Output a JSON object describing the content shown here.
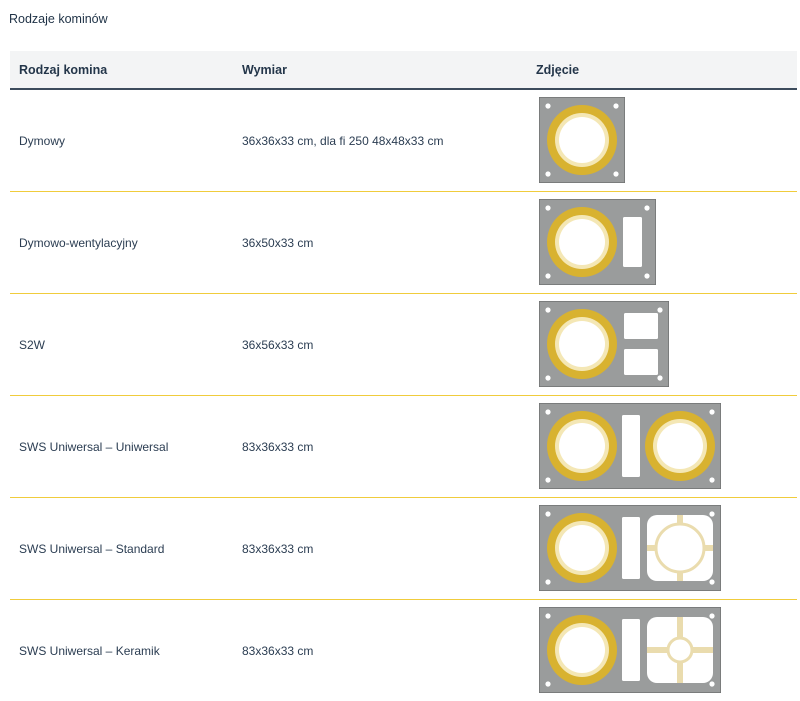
{
  "caption": "Rodzaje kominów",
  "headers": {
    "type": "Rodzaj komina",
    "size": "Wymiar",
    "photo": "Zdjęcie"
  },
  "rows": [
    {
      "type": "Dymowy",
      "size": "36x36x33 cm, dla fi 250 48x48x33 cm",
      "image": "chimney-single-flue"
    },
    {
      "type": "Dymowo-wentylacyjny",
      "size": "36x50x33 cm",
      "image": "chimney-flue-vent"
    },
    {
      "type": "S2W",
      "size": "36x56x33 cm",
      "image": "chimney-flue-two-vents"
    },
    {
      "type": "SWS Uniwersal – Uniwersal",
      "size": "83x36x33 cm",
      "image": "chimney-double-flue"
    },
    {
      "type": "SWS Uniwersal – Standard",
      "size": "83x36x33 cm",
      "image": "chimney-double-flue-standard"
    },
    {
      "type": "SWS Uniwersal – Keramik",
      "size": "83x36x33 cm",
      "image": "chimney-double-flue-keramik"
    }
  ],
  "colors": {
    "block": "#9a9c9c",
    "pipe": "#d8b230",
    "pipe_inner": "#f4e7b5",
    "row_border": "#f0cc3c",
    "header_border": "#3c4b5c"
  }
}
